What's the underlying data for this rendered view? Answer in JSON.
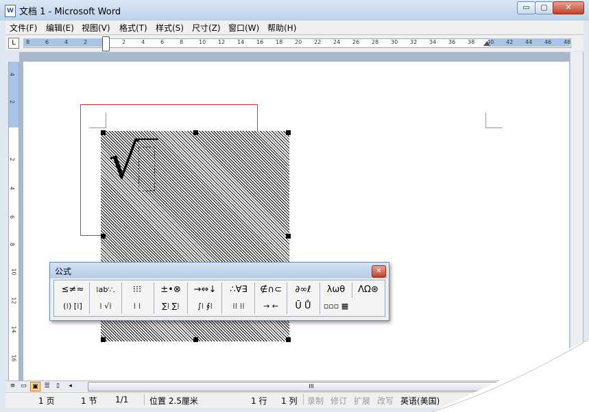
{
  "window": {
    "title": "文档 1 - Microsoft Word",
    "app_icon": "W",
    "minimize_glyph": "▭",
    "maximize_glyph": "▢",
    "close_glyph": "✕"
  },
  "menu": [
    {
      "label": "文件(F)"
    },
    {
      "label": "编辑(E)"
    },
    {
      "label": "视图(V)"
    },
    {
      "label": "格式(T)"
    },
    {
      "label": "样式(S)"
    },
    {
      "label": "尺寸(Z)"
    },
    {
      "label": "窗口(W)"
    },
    {
      "label": "帮助(H)"
    }
  ],
  "ruler": {
    "tab_selector": "L",
    "h_ticks": [
      "8",
      "6",
      "4",
      "2",
      "2",
      "4",
      "6",
      "8",
      "10",
      "12",
      "14",
      "16",
      "18",
      "20",
      "22",
      "24",
      "26",
      "28",
      "30",
      "32",
      "34",
      "36",
      "38",
      "40",
      "42",
      "44",
      "46",
      "48"
    ],
    "v_ticks": [
      "4",
      "2",
      "2",
      "4",
      "6",
      "8",
      "10",
      "12",
      "14",
      "16"
    ]
  },
  "equation": {
    "radical": "√"
  },
  "equation_toolbar": {
    "title": "公式",
    "close_glyph": "✕",
    "row1": [
      "≤≠≈",
      "⁞ab∵.",
      "⁝⁝⁝",
      "±•⊗",
      "→⇔↓",
      "∴∀∃",
      "∉∩⊂",
      "∂∞ℓ",
      "λωθ",
      "ΛΩ⊛"
    ],
    "row2": [
      "(⁞) [⁞]",
      "⁞ √⁞",
      "⁞ ⁞",
      "∑⁞ ∑⁞",
      "∫⁞ ∮⁞",
      "⁞⁞ ⁞⁞",
      "→ ←",
      "Ū Ů",
      "▫▫▫ ▦"
    ]
  },
  "scrollbar": {
    "thumb_grip": "III"
  },
  "status": {
    "page": "1 页",
    "section": "1 节",
    "page_of": "1/1",
    "position": "位置 2.5厘米",
    "line": "1 行",
    "column": "1 列",
    "rec": "录制",
    "trk": "修订",
    "ext": "扩展",
    "ovr": "改写",
    "language": "英语(美国)"
  }
}
